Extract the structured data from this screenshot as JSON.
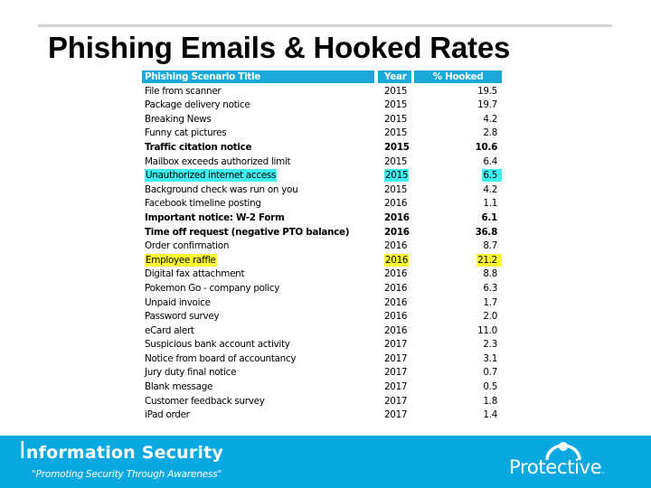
{
  "slide": {
    "title": "Phishing Emails & Hooked Rates"
  },
  "table": {
    "headers": {
      "title": "Phishing Scenario Title",
      "year": "Year",
      "hooked": "% Hooked"
    },
    "rows": [
      {
        "title": "File from scanner",
        "year": "2015",
        "hooked": "19.5",
        "bold": false,
        "highlight": ""
      },
      {
        "title": "Package delivery notice",
        "year": "2015",
        "hooked": "19.7",
        "bold": false,
        "highlight": ""
      },
      {
        "title": "Breaking News",
        "year": "2015",
        "hooked": "4.2",
        "bold": false,
        "highlight": ""
      },
      {
        "title": "Funny cat pictures",
        "year": "2015",
        "hooked": "2.8",
        "bold": false,
        "highlight": ""
      },
      {
        "title": "Traffic citation notice",
        "year": "2015",
        "hooked": "10.6",
        "bold": true,
        "highlight": ""
      },
      {
        "title": "Mailbox exceeds authorized limit",
        "year": "2015",
        "hooked": "6.4",
        "bold": false,
        "highlight": ""
      },
      {
        "title": "Unauthorized internet access",
        "year": "2015",
        "hooked": "6.5",
        "bold": false,
        "highlight": "cyan"
      },
      {
        "title": "Background check was run on you",
        "year": "2015",
        "hooked": "4.2",
        "bold": false,
        "highlight": ""
      },
      {
        "title": "Facebook timeline posting",
        "year": "2016",
        "hooked": "1.1",
        "bold": false,
        "highlight": ""
      },
      {
        "title": "Important notice: W-2 Form",
        "year": "2016",
        "hooked": "6.1",
        "bold": true,
        "highlight": ""
      },
      {
        "title": "Time off request (negative PTO balance)",
        "year": "2016",
        "hooked": "36.8",
        "bold": true,
        "highlight": ""
      },
      {
        "title": "Order confirmation",
        "year": "2016",
        "hooked": "8.7",
        "bold": false,
        "highlight": ""
      },
      {
        "title": "Employee raffle",
        "year": "2016",
        "hooked": "21.2",
        "bold": false,
        "highlight": "yellow"
      },
      {
        "title": "Digital fax attachment",
        "year": "2016",
        "hooked": "8.8",
        "bold": false,
        "highlight": ""
      },
      {
        "title": "Pokemon Go - company policy",
        "year": "2016",
        "hooked": "6.3",
        "bold": false,
        "highlight": ""
      },
      {
        "title": "Unpaid invoice",
        "year": "2016",
        "hooked": "1.7",
        "bold": false,
        "highlight": ""
      },
      {
        "title": "Password survey",
        "year": "2016",
        "hooked": "2.0",
        "bold": false,
        "highlight": ""
      },
      {
        "title": "eCard alert",
        "year": "2016",
        "hooked": "11.0",
        "bold": false,
        "highlight": ""
      },
      {
        "title": "Suspicious bank account activity",
        "year": "2017",
        "hooked": "2.3",
        "bold": false,
        "highlight": ""
      },
      {
        "title": "Notice from board of accountancy",
        "year": "2017",
        "hooked": "3.1",
        "bold": false,
        "highlight": ""
      },
      {
        "title": "Jury duty final notice",
        "year": "2017",
        "hooked": "0.7",
        "bold": false,
        "highlight": ""
      },
      {
        "title": "Blank message",
        "year": "2017",
        "hooked": "0.5",
        "bold": false,
        "highlight": ""
      },
      {
        "title": "Customer feedback survey",
        "year": "2017",
        "hooked": "1.8",
        "bold": false,
        "highlight": ""
      },
      {
        "title": "iPad order",
        "year": "2017",
        "hooked": "1.4",
        "bold": false,
        "highlight": ""
      }
    ]
  },
  "footer": {
    "title_initial": "I",
    "title_rest": "nformation Security",
    "tagline": "\"Promoting Security Through Awareness\"",
    "logo_text": "Protective",
    "logo_dot": "."
  },
  "colors": {
    "header_bg": "#1aa9d8",
    "footer_bg": "#0aa8e0",
    "highlight_cyan": "#3ff0f0",
    "highlight_yellow": "#ffff33",
    "rule": "#d3d3d3"
  }
}
